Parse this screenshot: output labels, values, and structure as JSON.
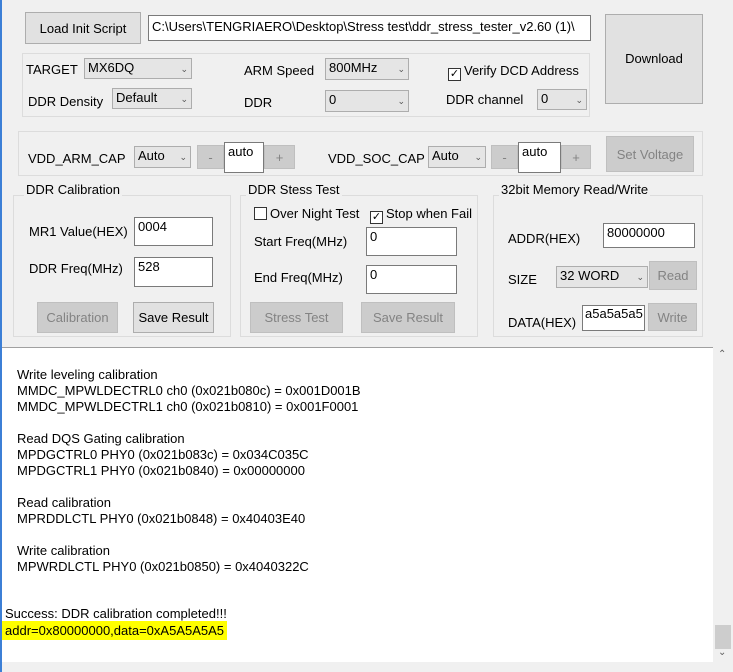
{
  "top": {
    "load_button": "Load Init Script",
    "script_path": "C:\\Users\\TENGRIAERO\\Desktop\\Stress test\\ddr_stress_tester_v2.60 (1)\\",
    "download_button": "Download"
  },
  "config": {
    "target_label": "TARGET",
    "target_value": "MX6DQ",
    "density_label": "DDR Density",
    "density_value": "Default",
    "arm_speed_label": "ARM Speed",
    "arm_speed_value": "800MHz",
    "ddr_label": "DDR",
    "ddr_value": "0",
    "verify_label": "Verify DCD Address",
    "verify_checked": true,
    "channel_label": "DDR channel",
    "channel_value": "0"
  },
  "voltage": {
    "arm_label": "VDD_ARM_CAP",
    "arm_mode": "Auto",
    "arm_value": "auto",
    "soc_label": "VDD_SOC_CAP",
    "soc_mode": "Auto",
    "soc_value": "auto",
    "minus": "-",
    "plus": "+",
    "set_button": "Set Voltage"
  },
  "calibration": {
    "title": "DDR Calibration",
    "mr1_label": "MR1 Value(HEX)",
    "mr1_value": "0004",
    "freq_label": "DDR Freq(MHz)",
    "freq_value": "528",
    "calibration_button": "Calibration",
    "save_button": "Save Result"
  },
  "stress": {
    "title": "DDR Stess Test",
    "overnight_label": "Over Night Test",
    "overnight_checked": false,
    "stop_label": "Stop when Fail",
    "stop_checked": true,
    "start_label": "Start Freq(MHz)",
    "start_value": "0",
    "end_label": "End Freq(MHz)",
    "end_value": "0",
    "stress_button": "Stress Test",
    "save_button": "Save Result"
  },
  "memory": {
    "title": "32bit Memory Read/Write",
    "addr_label": "ADDR(HEX)",
    "addr_value": "80000000",
    "size_label": "SIZE",
    "size_value": "32 WORD",
    "read_button": "Read",
    "data_label": "DATA(HEX)",
    "data_value": "a5a5a5a5",
    "write_button": "Write"
  },
  "log": {
    "lines": [
      "Write leveling calibration",
      "MMDC_MPWLDECTRL0 ch0 (0x021b080c) = 0x001D001B",
      "MMDC_MPWLDECTRL1 ch0 (0x021b0810) = 0x001F0001",
      "Read DQS Gating calibration",
      "MPDGCTRL0 PHY0 (0x021b083c) = 0x034C035C",
      "MPDGCTRL1 PHY0 (0x021b0840) = 0x00000000",
      "Read calibration",
      "MPRDDLCTL PHY0 (0x021b0848) = 0x40403E40",
      "Write calibration",
      "MPWRDLCTL PHY0 (0x021b0850) = 0x4040322C"
    ],
    "success": "Success: DDR calibration completed!!!",
    "highlight": "addr=0x80000000,data=0xA5A5A5A5",
    "highlight_color": "#ffff00"
  }
}
